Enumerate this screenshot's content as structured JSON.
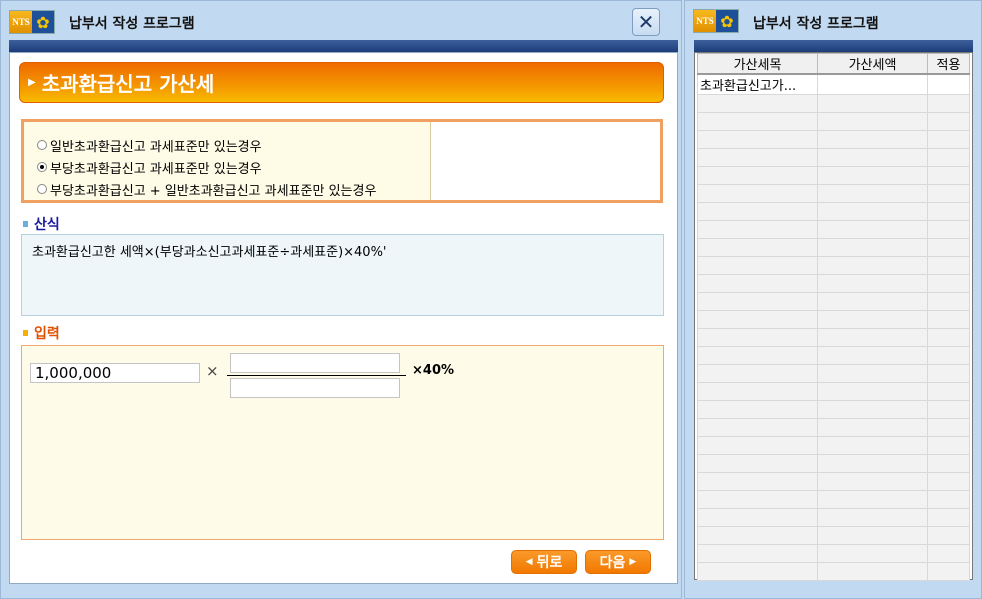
{
  "left_window": {
    "logo_text": "NTS",
    "title": "납부서 작성 프로그램",
    "close_label": "✕",
    "header": "초과환급신고 가산세",
    "options": [
      {
        "label": "일반초과환급신고 과세표준만 있는경우",
        "selected": false
      },
      {
        "label": "부당초과환급신고 과세표준만 있는경우",
        "selected": true
      },
      {
        "label": "부당초과환급신고 + 일반초과환급신고 과세표준만 있는경우",
        "selected": false
      }
    ],
    "formula_title": "산식",
    "formula": "초과환급신고한 세액×(부당과소신고과세표준÷과세표준)×40%'",
    "input_title": "입력",
    "amount": "1,000,000",
    "times": "×",
    "numerator": "",
    "denominator": "",
    "rate": "×40%",
    "back_label": "뒤로",
    "next_label": "다음"
  },
  "right_window": {
    "logo_text": "NTS",
    "title": "납부서 작성 프로그램",
    "columns": [
      "가산세목",
      "가산세액",
      "적용"
    ],
    "rows": [
      [
        "초과환급신고가...",
        "",
        ""
      ]
    ]
  }
}
